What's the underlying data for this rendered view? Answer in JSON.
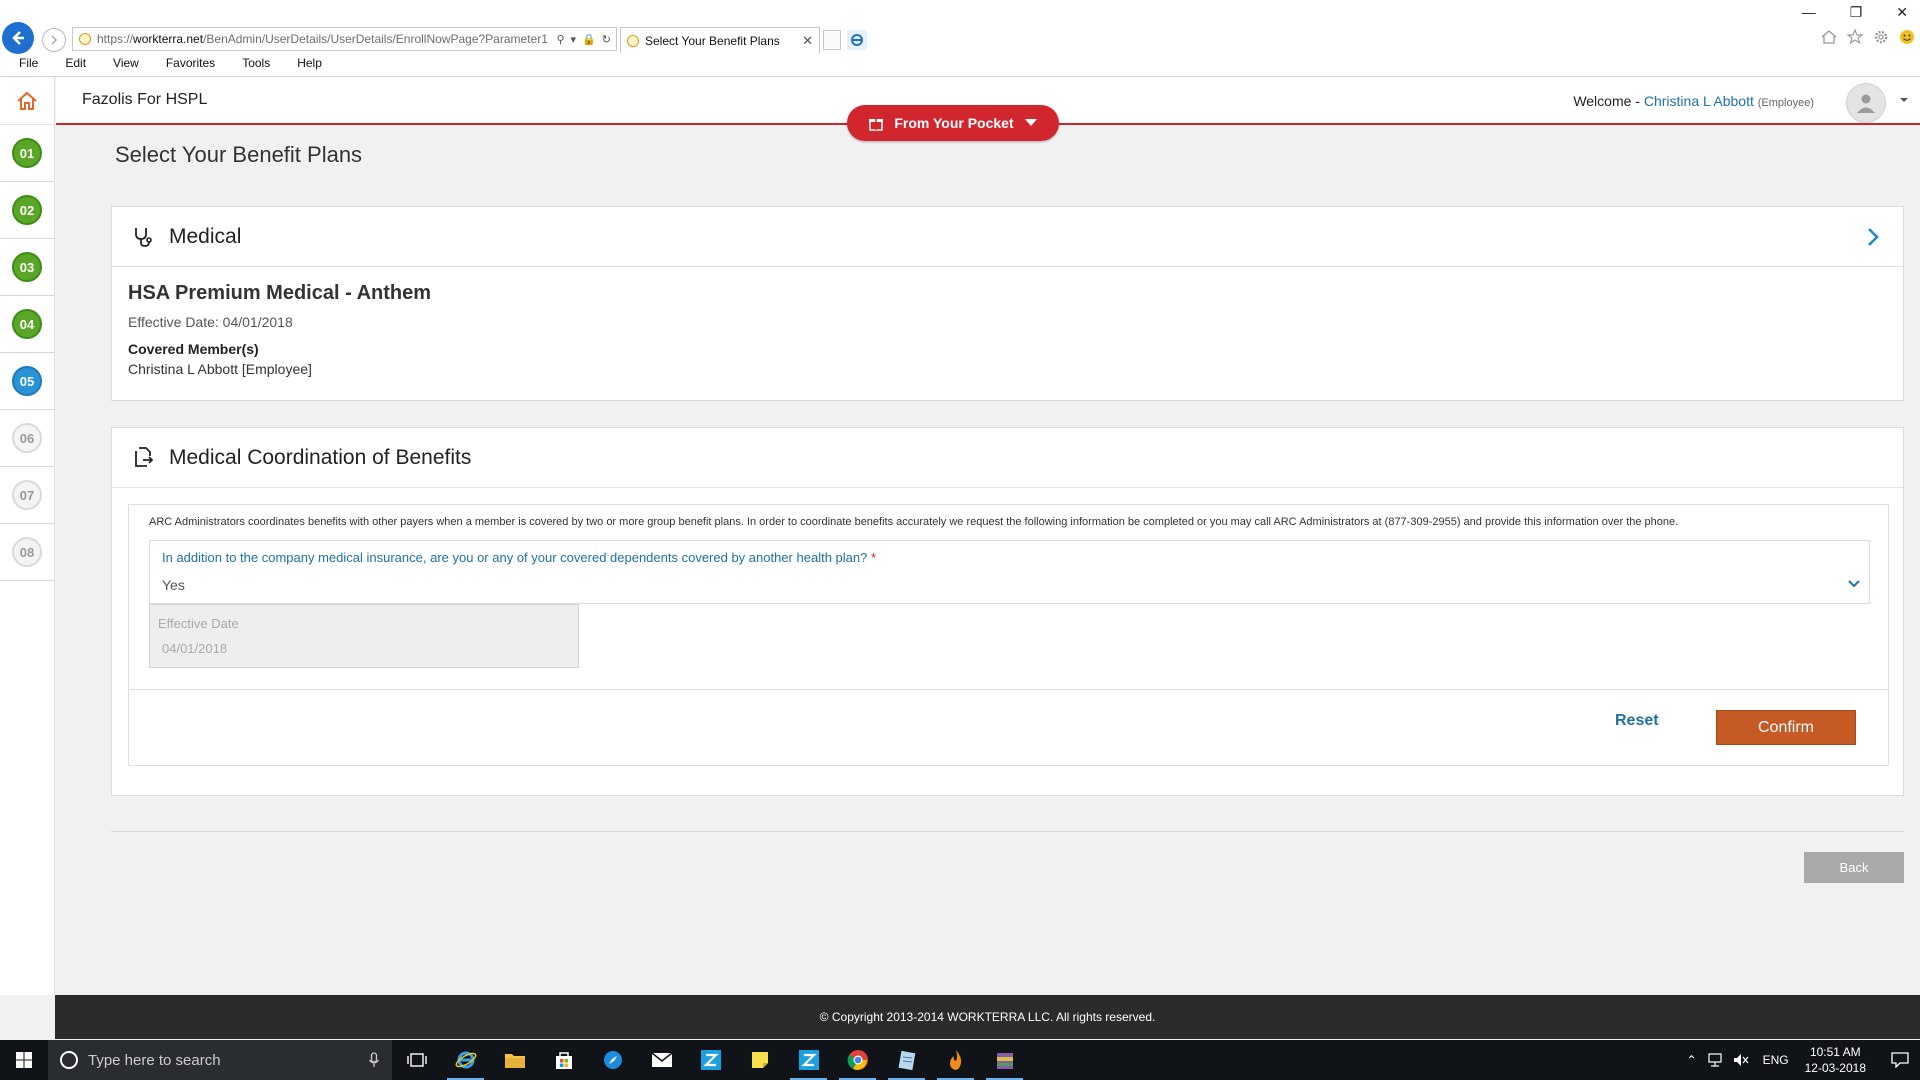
{
  "browser": {
    "url_prefix": "https://",
    "url_domain": "workterra.net",
    "url_path": "/BenAdmin/UserDetails/UserDetails/EnrollNowPage?Parameter1",
    "tab_title": "Select Your Benefit Plans",
    "menu": [
      "File",
      "Edit",
      "View",
      "Favorites",
      "Tools",
      "Help"
    ]
  },
  "header": {
    "company": "Fazolis For HSPL",
    "welcome_prefix": "Welcome -",
    "user_name": "Christina L Abbott",
    "user_role": "(Employee)",
    "pocket_label": "From Your Pocket"
  },
  "steps": [
    {
      "label": "01",
      "state": "done"
    },
    {
      "label": "02",
      "state": "done"
    },
    {
      "label": "03",
      "state": "done"
    },
    {
      "label": "04",
      "state": "done"
    },
    {
      "label": "05",
      "state": "active"
    },
    {
      "label": "06",
      "state": "todo"
    },
    {
      "label": "07",
      "state": "todo"
    },
    {
      "label": "08",
      "state": "todo"
    }
  ],
  "page": {
    "title": "Select Your Benefit Plans"
  },
  "medical": {
    "title": "Medical",
    "plan_name": "HSA Premium Medical - Anthem",
    "effective": "Effective Date: 04/01/2018",
    "covered_heading": "Covered Member(s)",
    "covered_member": "Christina L Abbott [Employee]"
  },
  "cob": {
    "title": "Medical Coordination of Benefits",
    "info": "ARC Administrators coordinates benefits with other payers when a member is covered by two or more group benefit plans. In order to coordinate benefits accurately we request the following information be completed or you may call ARC Administrators at (877-309-2955) and provide this information over the phone.",
    "question": "In addition to the company medical insurance, are you or any of your covered dependents covered by another health plan?",
    "required_mark": "*",
    "answer": "Yes",
    "effective_label": "Effective Date",
    "effective_value": "04/01/2018",
    "reset_label": "Reset",
    "confirm_label": "Confirm"
  },
  "back_label": "Back",
  "footer": "© Copyright 2013-2014 WORKTERRA LLC. All rights reserved.",
  "taskbar": {
    "search_placeholder": "Type here to search",
    "lang": "ENG",
    "time": "10:51 AM",
    "date": "12-03-2018"
  },
  "colors": {
    "brand_red": "#d1262d",
    "step_done": "#5aa627",
    "step_active": "#2a93d5",
    "confirm": "#c55a25",
    "link_blue": "#1e70a8"
  }
}
